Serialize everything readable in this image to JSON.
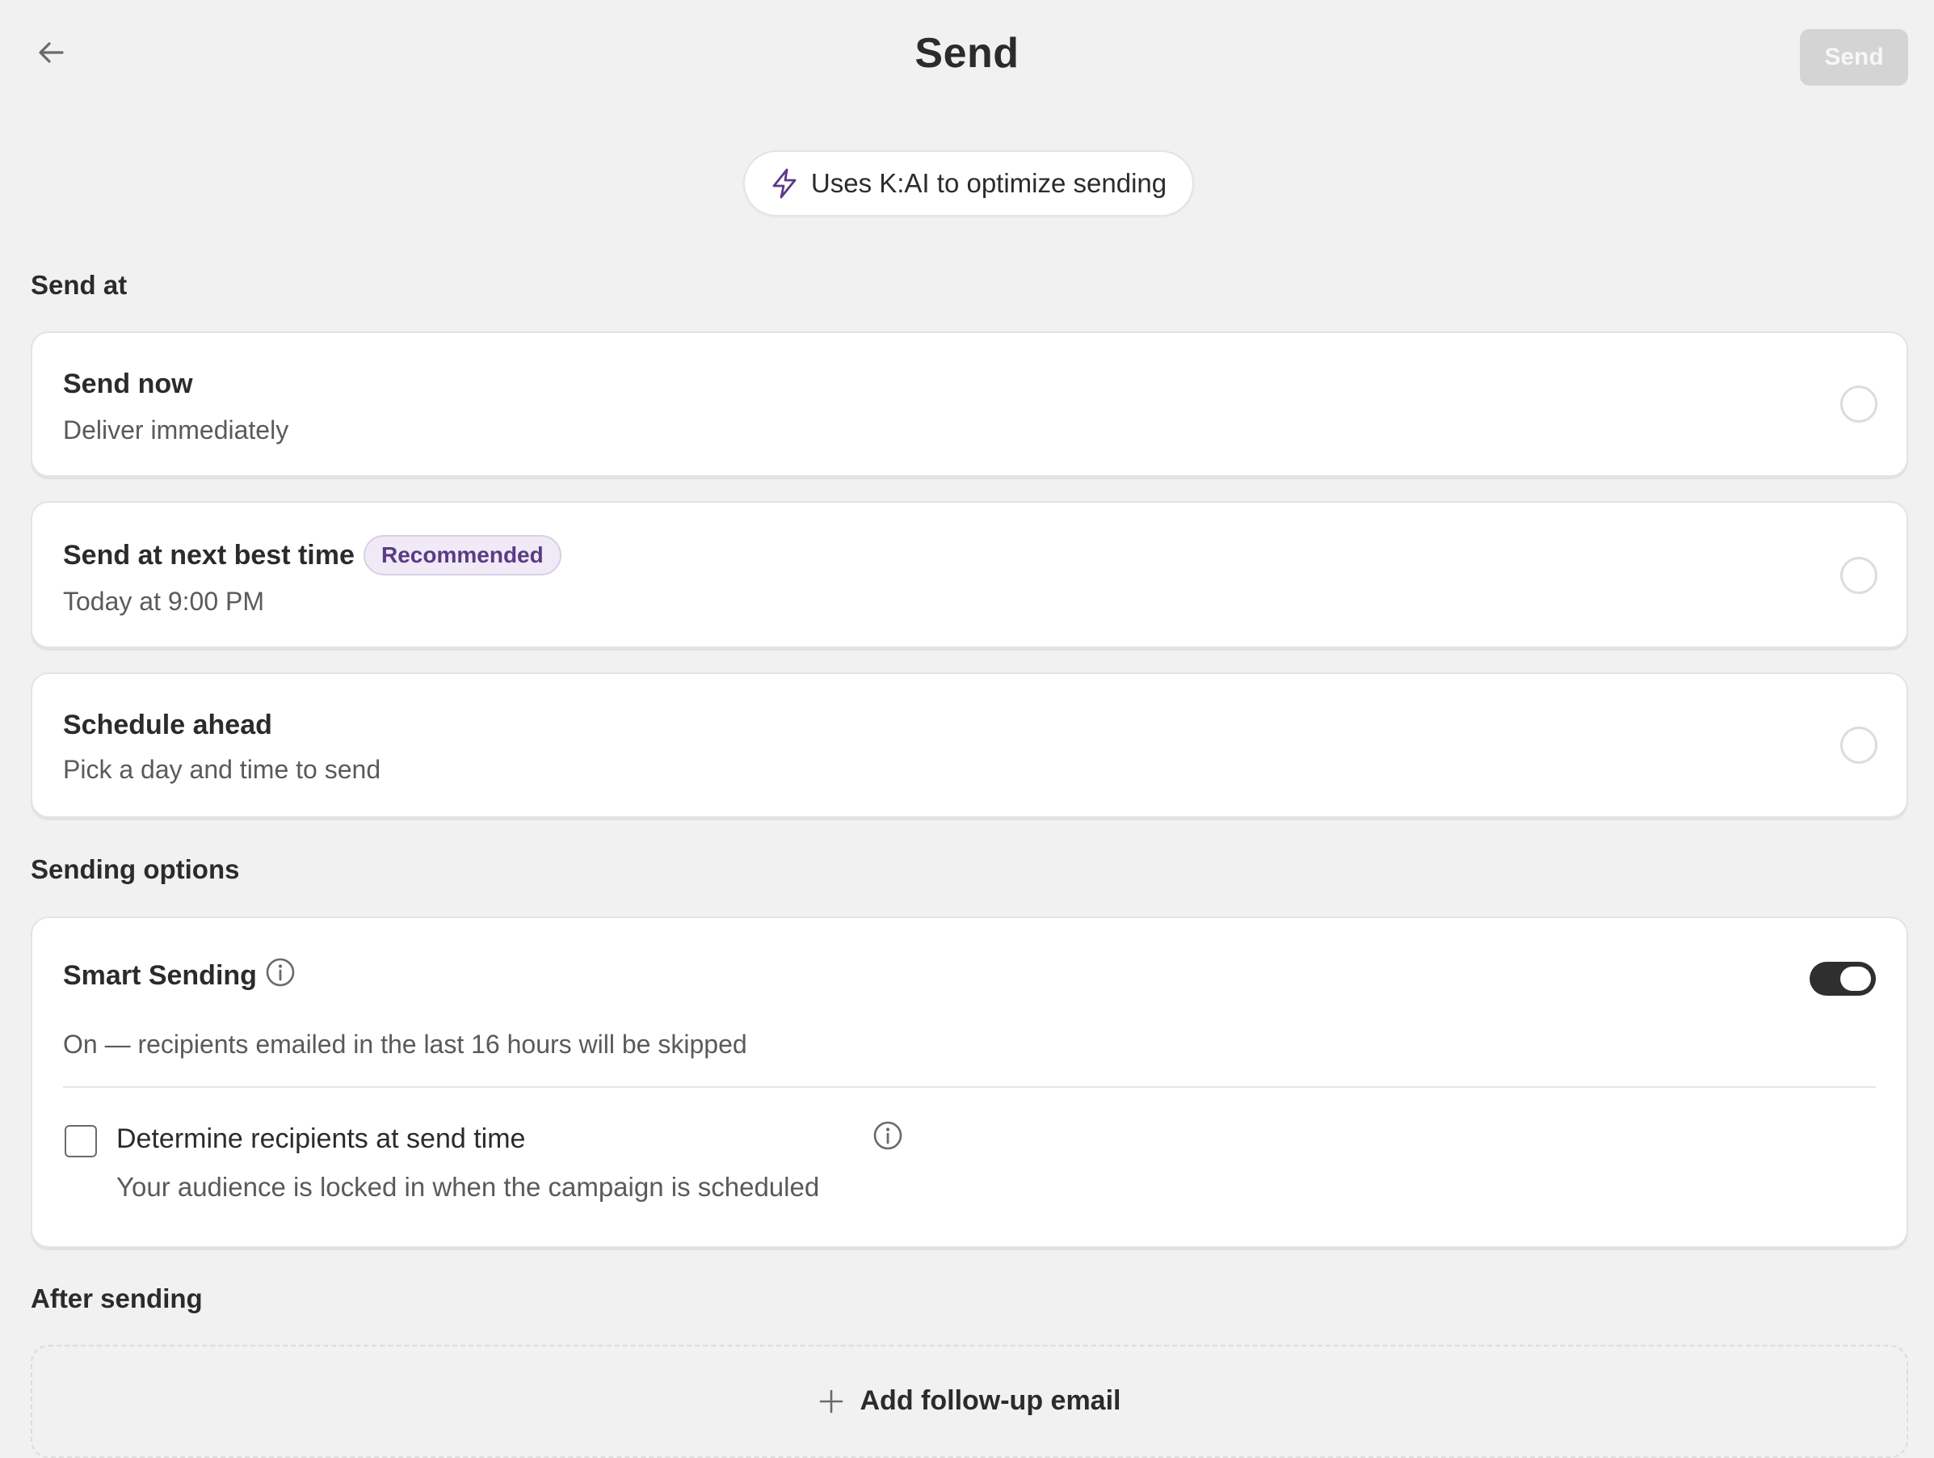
{
  "header": {
    "title": "Send",
    "send_button_label": "Send",
    "back_icon": "arrow-left-icon"
  },
  "ai_pill": {
    "icon": "lightning-icon",
    "text": "Uses K:AI to optimize sending",
    "accent_color": "#5b3a86"
  },
  "send_at": {
    "section_label": "Send at",
    "options": [
      {
        "title": "Send now",
        "subtitle": "Deliver immediately",
        "selected": false
      },
      {
        "title": "Send at next best time",
        "subtitle": "Today at 9:00 PM",
        "badge": "Recommended",
        "selected": false
      },
      {
        "title": "Schedule ahead",
        "subtitle": "Pick a day and time to send",
        "selected": false
      }
    ]
  },
  "sending_options": {
    "section_label": "Sending options",
    "smart_sending": {
      "title": "Smart Sending",
      "enabled": true,
      "description": "On — recipients emailed in the last 16 hours will be skipped"
    },
    "determine_recipients": {
      "label": "Determine recipients at send time",
      "description": "Your audience is locked in when the campaign is scheduled",
      "checked": false
    }
  },
  "after_sending": {
    "section_label": "After sending",
    "add_followup_label": "Add follow-up email"
  },
  "colors": {
    "background": "#f1f1f1",
    "card": "#ffffff",
    "toggle_on": "#2f2f2f",
    "badge_bg": "#efeaf5",
    "badge_text": "#5b3a86",
    "disabled_button": "#d4d4d4"
  }
}
